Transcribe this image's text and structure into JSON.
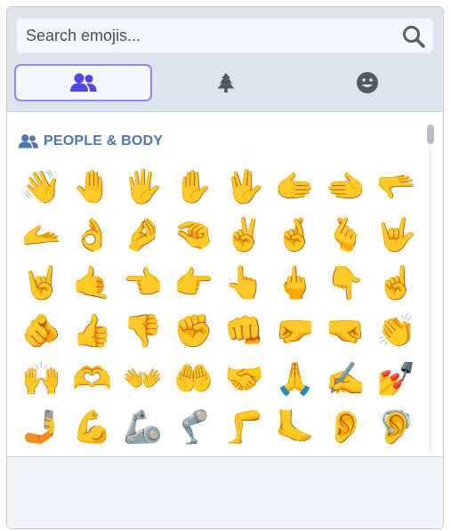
{
  "search": {
    "placeholder": "Search emojis..."
  },
  "tabs": [
    {
      "name": "people",
      "icon": "users-icon",
      "active": true
    },
    {
      "name": "nature",
      "icon": "tree-icon",
      "active": false
    },
    {
      "name": "smileys",
      "icon": "smiley-icon",
      "active": false
    }
  ],
  "category": {
    "title": "PEOPLE & BODY",
    "icon": "users-icon"
  },
  "emojis": [
    "👋",
    "🤚",
    "🖐️",
    "✋",
    "🖖",
    "🫱",
    "🫲",
    "🫳",
    "🫴",
    "👌",
    "🤌",
    "🤏",
    "✌️",
    "🤞",
    "🫰",
    "🤟",
    "🤘",
    "🤙",
    "👈",
    "👉",
    "👆",
    "🖕",
    "👇",
    "☝️",
    "🫵",
    "👍",
    "👎",
    "✊",
    "👊",
    "🤛",
    "🤜",
    "👏",
    "🙌",
    "🫶",
    "👐",
    "🤲",
    "🤝",
    "🙏",
    "✍️",
    "💅",
    "🤳",
    "💪",
    "🦾",
    "🦿",
    "🦵",
    "🦶",
    "👂",
    "🦻"
  ],
  "colors": {
    "accent": "#8e86f0",
    "tab_active_icon": "#5147e8",
    "tab_icon": "#555a60",
    "category": "#4b78ad"
  }
}
